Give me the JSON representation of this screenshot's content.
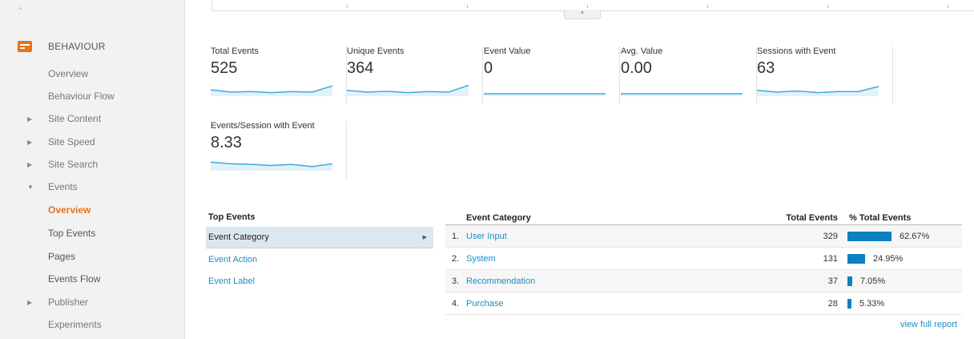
{
  "sidebar": {
    "handle": "″",
    "section_label": "BEHAVIOUR",
    "items": [
      {
        "label": "Overview",
        "caret": ""
      },
      {
        "label": "Behaviour Flow",
        "caret": ""
      },
      {
        "label": "Site Content",
        "caret": "▶"
      },
      {
        "label": "Site Speed",
        "caret": "▶"
      },
      {
        "label": "Site Search",
        "caret": "▶"
      },
      {
        "label": "Events",
        "caret": "▼"
      },
      {
        "label": "Overview",
        "caret": ""
      },
      {
        "label": "Top Events",
        "caret": ""
      },
      {
        "label": "Pages",
        "caret": ""
      },
      {
        "label": "Events Flow",
        "caret": ""
      },
      {
        "label": "Publisher",
        "caret": "▶"
      },
      {
        "label": "Experiments",
        "caret": ""
      }
    ]
  },
  "expander_glyph": "▾",
  "metrics": [
    {
      "label": "Total Events",
      "value": "525",
      "spark": [
        0.35,
        0.15,
        0.2,
        0.1,
        0.2,
        0.15,
        0.7
      ]
    },
    {
      "label": "Unique Events",
      "value": "364",
      "spark": [
        0.3,
        0.15,
        0.22,
        0.1,
        0.2,
        0.15,
        0.75
      ]
    },
    {
      "label": "Event Value",
      "value": "0",
      "spark": [
        0,
        0,
        0,
        0,
        0,
        0,
        0
      ]
    },
    {
      "label": "Avg. Value",
      "value": "0.00",
      "spark": [
        0,
        0,
        0,
        0,
        0,
        0,
        0
      ]
    },
    {
      "label": "Sessions with Event",
      "value": "63",
      "spark": [
        0.3,
        0.15,
        0.25,
        0.1,
        0.2,
        0.2,
        0.65
      ]
    },
    {
      "label": "Events/Session with Event",
      "value": "8.33",
      "spark": [
        0.55,
        0.4,
        0.35,
        0.25,
        0.35,
        0.15,
        0.4
      ]
    }
  ],
  "top_events": {
    "title": "Top Events",
    "selected_arrow": "▶",
    "items": [
      "Event Category",
      "Event Action",
      "Event Label"
    ]
  },
  "category_table": {
    "col_category": "Event Category",
    "col_total": "Total Events",
    "col_pct": "% Total Events",
    "rows": [
      {
        "num": "1.",
        "name": "User Input",
        "total": "329",
        "pct": "62.67%",
        "share": 0.6267
      },
      {
        "num": "2.",
        "name": "System",
        "total": "131",
        "pct": "24.95%",
        "share": 0.2495
      },
      {
        "num": "3.",
        "name": "Recommendation",
        "total": "37",
        "pct": "7.05%",
        "share": 0.0705
      },
      {
        "num": "4.",
        "name": "Purchase",
        "total": "28",
        "pct": "5.33%",
        "share": 0.0533
      }
    ]
  },
  "view_full_report": "view full report",
  "colors": {
    "accent": "#e8711a",
    "link": "#1a8ec2",
    "bar": "#0c80c0",
    "spark": "#3fa9e0"
  }
}
